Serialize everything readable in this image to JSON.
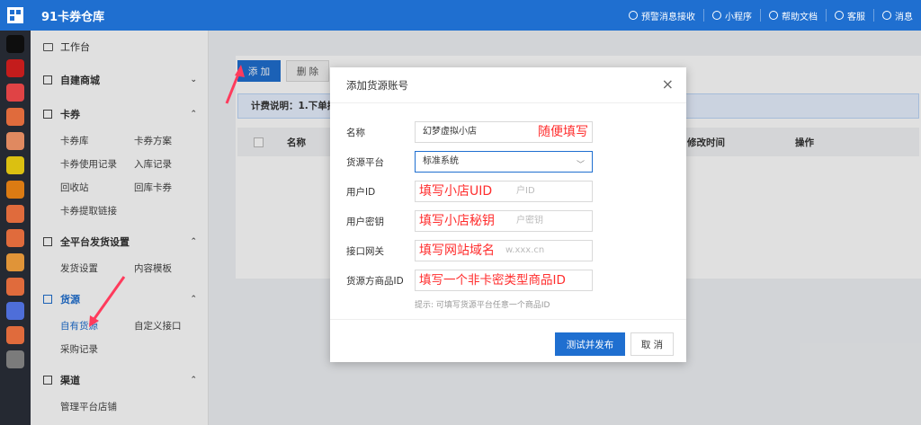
{
  "app": {
    "title": "91卡券仓库"
  },
  "topbar": {
    "links": [
      {
        "label": "预警消息接收",
        "icon": "bell-icon"
      },
      {
        "label": "小程序",
        "icon": "miniprogram-icon"
      },
      {
        "label": "帮助文档",
        "icon": "doc-icon"
      },
      {
        "label": "客服",
        "icon": "headset-icon"
      },
      {
        "label": "消息",
        "icon": "mail-icon"
      }
    ]
  },
  "rail": {
    "icons": [
      {
        "name": "tiktok-icon",
        "color": "#111111"
      },
      {
        "name": "xiaohongshu-icon",
        "color": "#e02020"
      },
      {
        "name": "app-grid-icon",
        "color": "#ff4d4f"
      },
      {
        "name": "shop-icon",
        "color": "#ff7a45"
      },
      {
        "name": "gift-icon",
        "color": "#ff9c6e"
      },
      {
        "name": "coupon-icon",
        "color": "#fadb14"
      },
      {
        "name": "wifi-icon",
        "color": "#fa8c16"
      },
      {
        "name": "thumb-icon",
        "color": "#ff7a45"
      },
      {
        "name": "store-icon",
        "color": "#ff7a45"
      },
      {
        "name": "tag-icon",
        "color": "#ffa940"
      },
      {
        "name": "box-icon",
        "color": "#ff7a45"
      },
      {
        "name": "link-icon",
        "color": "#597ef7"
      },
      {
        "name": "home-icon",
        "color": "#ff7a45"
      },
      {
        "name": "keyboard-icon",
        "color": "#8c8c8c"
      }
    ]
  },
  "sidebar": {
    "workbench": "工作台",
    "sections": [
      {
        "label": "自建商城",
        "chev": "⌄",
        "items": []
      },
      {
        "label": "卡券",
        "chev": "⌃",
        "items": [
          "卡券库",
          "卡券方案",
          "卡券使用记录",
          "入库记录",
          "回收站",
          "回库卡券",
          "卡券提取链接"
        ]
      },
      {
        "label": "全平台发货设置",
        "chev": "⌃",
        "items": [
          "发货设置",
          "内容模板"
        ]
      },
      {
        "label": "货源",
        "chev": "⌃",
        "items": [
          "自有货源",
          "自定义接口",
          "采购记录"
        ]
      },
      {
        "label": "渠道",
        "chev": "⌃",
        "items": [
          "管理平台店铺"
        ]
      }
    ]
  },
  "main": {
    "add_label": "添 加",
    "delete_label": "删 除",
    "notice": "计费说明：1.下单接",
    "columns": {
      "name": "名称",
      "modified": "修改时间",
      "operation": "操作"
    }
  },
  "modal": {
    "title": "添加货源账号",
    "close": "×",
    "fields": [
      {
        "label": "名称",
        "value": "幻梦虚拟小店",
        "placeholder": "",
        "overlay": "随便填写"
      },
      {
        "label": "货源平台",
        "value": "标准系统",
        "placeholder": "",
        "overlay": ""
      },
      {
        "label": "用户ID",
        "value": "",
        "placeholder": "户ID",
        "overlay": "填写小店UID"
      },
      {
        "label": "用户密钥",
        "value": "",
        "placeholder": "户密钥",
        "overlay": "填写小店秘钥"
      },
      {
        "label": "接口网关",
        "value": "",
        "placeholder": "w.xxx.cn",
        "overlay": "填写网站域名"
      },
      {
        "label": "货源方商品ID",
        "value": "",
        "placeholder": "",
        "overlay": "填写一个非卡密类型商品ID"
      }
    ],
    "hint": "提示: 可填写货源平台任意一个商品ID",
    "submit_label": "测试并发布",
    "cancel_label": "取 消"
  },
  "colors": {
    "brand": "#1f6fd0",
    "annotation": "#ff2d2d"
  }
}
